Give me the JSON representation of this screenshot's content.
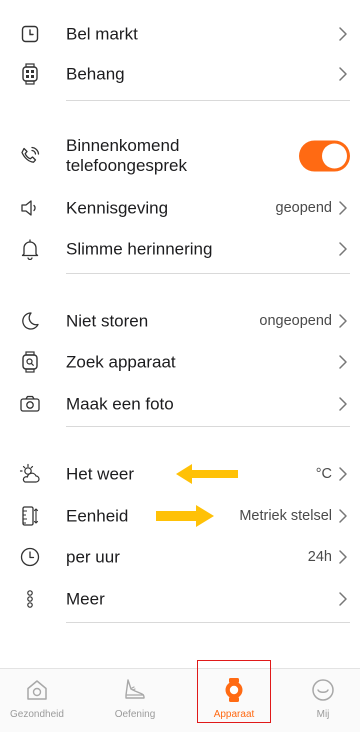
{
  "rows": {
    "bel_markt": {
      "label": "Bel markt"
    },
    "behang": {
      "label": "Behang"
    },
    "binnenkomend": {
      "label_line1": "Binnenkomend",
      "label_line2": "telefoongesprek",
      "toggle_on": true
    },
    "kennisgeving": {
      "label": "Kennisgeving",
      "value": "geopend"
    },
    "slimme": {
      "label": "Slimme herinnering"
    },
    "niet_storen": {
      "label": "Niet storen",
      "value": "ongeopend"
    },
    "zoek": {
      "label": "Zoek apparaat"
    },
    "foto": {
      "label": "Maak een foto"
    },
    "weer": {
      "label": "Het weer",
      "value": "°C"
    },
    "eenheid": {
      "label": "Eenheid",
      "value": "Metriek stelsel"
    },
    "per_uur": {
      "label": "per uur",
      "value": "24h"
    },
    "meer": {
      "label": "Meer"
    }
  },
  "tabbar": {
    "tabs": [
      {
        "label": "Gezondheid",
        "icon": "home-icon"
      },
      {
        "label": "Oefening",
        "icon": "sneaker-icon"
      },
      {
        "label": "Apparaat",
        "icon": "watch-icon",
        "active": true
      },
      {
        "label": "Mij",
        "icon": "profile-icon"
      }
    ]
  },
  "colors": {
    "accent": "#ff6a13",
    "annotation_arrow": "#ffc107",
    "highlight_box": "#e01919"
  }
}
